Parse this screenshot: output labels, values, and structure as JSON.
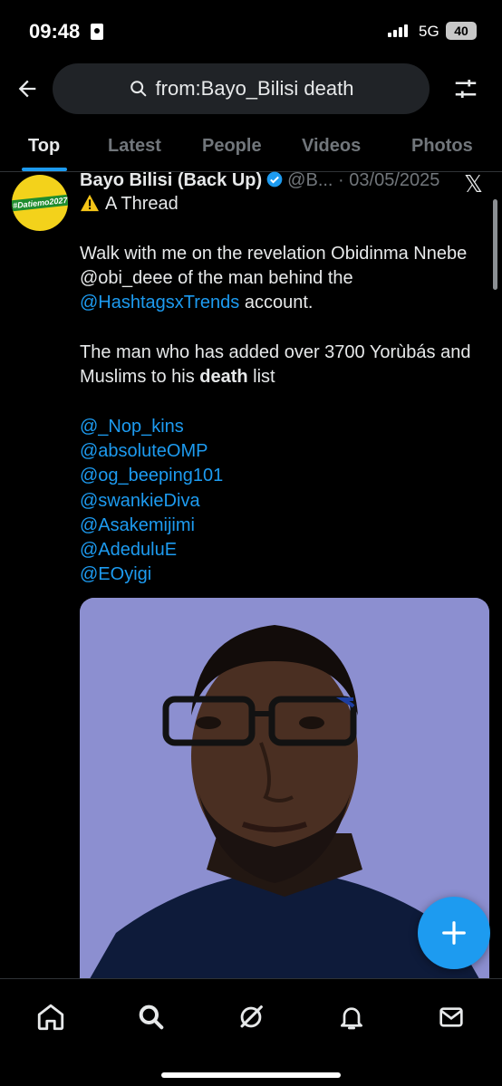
{
  "status_bar": {
    "time": "09:48",
    "network": "5G",
    "battery": "40"
  },
  "search": {
    "query": "from:Bayo_Bilisi death"
  },
  "tabs": [
    {
      "label": "Top",
      "active": true
    },
    {
      "label": "Latest",
      "active": false
    },
    {
      "label": "People",
      "active": false
    },
    {
      "label": "Videos",
      "active": false
    },
    {
      "label": "Photos",
      "active": false
    }
  ],
  "tweet": {
    "author_name": "Bayo Bilisi (Back Up)",
    "handle": "@B...",
    "separator": "·",
    "date": "03/05/2025",
    "avatar_label": "#Datiemo2027",
    "thread_label": "A Thread",
    "para1_before": "Walk with me on the revelation Obidinma Nnebe @obi_deee of the man behind the",
    "para1_link": "@HashtagsxTrends",
    "para1_after": " account.",
    "para2_before": "The man who has added over 3700 Yorùbás and Muslims to his ",
    "para2_bold": "death",
    "para2_after": " list",
    "mentions": [
      "@_Nop_kins",
      "@absoluteOMP",
      "@og_beeping101",
      "@swankieDiva",
      "@Asakemijimi",
      "@AdeduluE",
      "@EOyigi"
    ]
  },
  "colors": {
    "accent": "#1d9bf0",
    "background": "#000000",
    "secondary_text": "#71767b"
  },
  "icons": {
    "back": "arrow-left-icon",
    "search": "search-icon",
    "filter": "sliders-icon",
    "compose": "plus-icon",
    "nav": [
      "home-icon",
      "search-icon",
      "grok-icon",
      "bell-icon",
      "mail-icon"
    ]
  }
}
